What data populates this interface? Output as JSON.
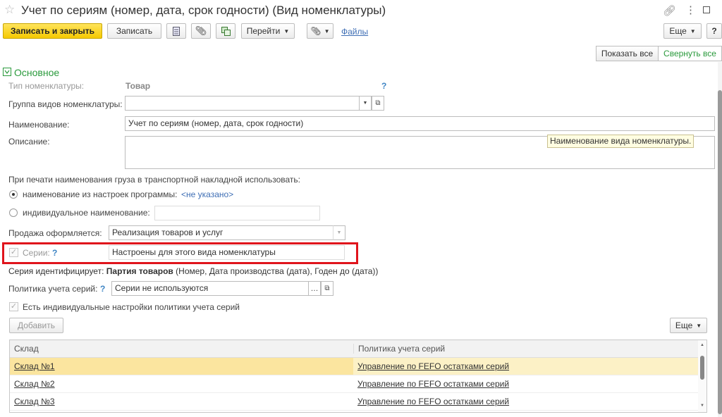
{
  "window": {
    "title": "Учет по сериям (номер, дата, срок годности) (Вид номенклатуры)"
  },
  "toolbar": {
    "save_close": "Записать и закрыть",
    "save": "Записать",
    "goto": "Перейти",
    "files": "Файлы",
    "more": "Еще",
    "help": "?"
  },
  "toggles": {
    "show_all": "Показать все",
    "collapse_all": "Свернуть все"
  },
  "section": {
    "title": "Основное"
  },
  "form": {
    "type_label": "Тип номенклатуры:",
    "type_value": "Товар",
    "hint": "?",
    "group_label": "Группа видов номенклатуры:",
    "group_value": "",
    "name_label": "Наименование:",
    "name_value": "Учет по сериям (номер, дата, срок годности)",
    "desc_label": "Описание:",
    "desc_value": "",
    "tooltip": "Наименование вида номенклатуры.",
    "print_label": "При печати наименования груза в транспортной накладной использовать:",
    "radio1_label": "наименование из настроек программы:",
    "radio1_value": "<не указано>",
    "radio2_label": "индивидуальное наименование:",
    "radio2_value": "",
    "sale_label": "Продажа оформляется:",
    "sale_value": "Реализация товаров и услуг",
    "series_label": "Серии:",
    "series_value": "Настроены для этого вида номенклатуры",
    "series_id_prefix": "Серия идентифицирует:",
    "series_id_bold": "Партия товаров",
    "series_id_rest": "(Номер, Дата производства (дата), Годен до (дата))",
    "policy_label": "Политика учета серий:",
    "policy_value": "Серии не используются",
    "individual_label": "Есть индивидуальные настройки политики учета серий"
  },
  "table_toolbar": {
    "add": "Добавить",
    "more": "Еще"
  },
  "table": {
    "headers": [
      "Склад",
      "Политика учета серий"
    ],
    "rows": [
      {
        "warehouse": "Склад №1",
        "policy": "Управление по FEFO остатками серий"
      },
      {
        "warehouse": "Склад №2",
        "policy": "Управление по FEFO остатками серий"
      },
      {
        "warehouse": "Склад №3",
        "policy": "Управление по FEFO остатками серий"
      }
    ]
  },
  "colors": {
    "highlight_box": "#e0141c",
    "selected_row": "#fbe59f",
    "section_green": "#2a9a3c",
    "primary_button": "#f5c900"
  }
}
